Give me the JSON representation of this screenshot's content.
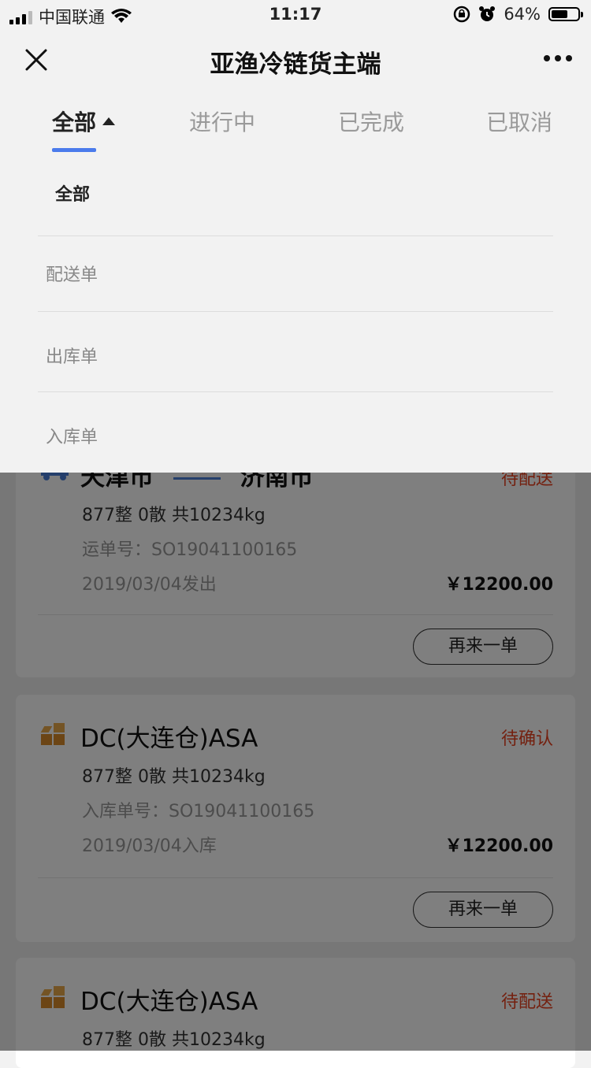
{
  "status_bar": {
    "carrier": "中国联通",
    "time": "11:17",
    "battery": "64%",
    "battery_level": 0.64,
    "icons": [
      "signal-icon",
      "wifi-icon",
      "rotation-lock-icon",
      "alarm-icon",
      "battery-icon"
    ]
  },
  "navbar": {
    "title": "亚渔冷链货主端",
    "icons": [
      "close-icon",
      "more-icon"
    ]
  },
  "tabs": [
    {
      "label": "全部"
    },
    {
      "label": "进行中"
    },
    {
      "label": "已完成"
    },
    {
      "label": "已取消"
    }
  ],
  "dropdown": {
    "items": [
      {
        "label": "全部"
      },
      {
        "label": "配送单"
      },
      {
        "label": "出库单"
      },
      {
        "label": "入库单"
      }
    ]
  },
  "orders": [
    {
      "from": "天津市",
      "to": "济南市",
      "status": "待配送",
      "summary": "877整  0散  共10234kg",
      "number_line": "运单号：SO19041100165",
      "date_line": "2019/03/04发出",
      "price": "￥12200.00",
      "button": "再来一单",
      "icon": "truck-icon"
    },
    {
      "title": "DC(大连仓)ASA",
      "status": "待确认",
      "summary": "877整  0散  共10234kg",
      "number_line": "入库单号：SO19041100165",
      "date_line": "2019/03/04入库",
      "price": "￥12200.00",
      "button": "再来一单",
      "icon": "warehouse-icon"
    },
    {
      "title": "DC(大连仓)ASA",
      "status": "待配送",
      "summary": "877整  0散  共10234kg",
      "icon": "warehouse-icon"
    }
  ]
}
